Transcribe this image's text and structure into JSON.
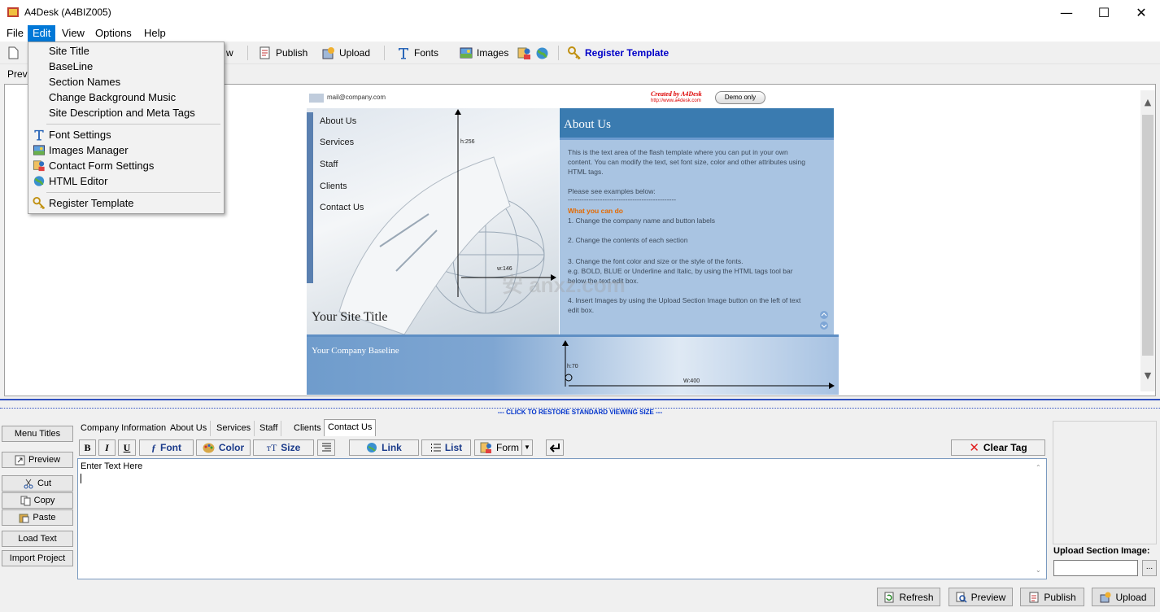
{
  "window": {
    "title": "A4Desk (A4BIZ005)",
    "controls": {
      "minimize": "—",
      "maximize": "☐",
      "close": "✕"
    }
  },
  "menubar": {
    "items": [
      "File",
      "Edit",
      "View",
      "Options",
      "Help"
    ],
    "active": "Edit"
  },
  "toolbar": {
    "partial_label": "w",
    "publish": "Publish",
    "upload": "Upload",
    "fonts": "Fonts",
    "images": "Images",
    "register": "Register Template"
  },
  "edit_menu": {
    "group1": [
      "Site Title",
      "BaseLine",
      "Section Names",
      "Change Background Music",
      "Site Description and Meta Tags"
    ],
    "group2": [
      "Font Settings",
      "Images Manager",
      "Contact Form Settings",
      "HTML Editor"
    ],
    "group3": [
      "Register Template"
    ]
  },
  "preview_tab": "Previ",
  "template": {
    "email": "mail@company.com",
    "created_by": "Created by A4Desk",
    "created_url": "http://www.a4desk.com",
    "demo_badge": "Demo only",
    "nav": [
      "About Us",
      "Services",
      "Staff",
      "Clients",
      "Contact Us"
    ],
    "panel_title": "About Us",
    "body": {
      "p1": "This is the text area of the flash template where you can put in your own content.  You can modify the text, set font size, color and other attributes using HTML tags.",
      "p2": "Please see examples below:",
      "rule": "-----------------------------------------------",
      "what_label": "What you can do",
      "item1": "1. Change the company name and button labels",
      "item2": "2. Change the contents of each section",
      "item3": "3. Change the font color and size or the style of the fonts.",
      "item3b": "e.g. BOLD, BLUE  or Underline and Italic, by using the HTML tags tool bar below the text edit box.",
      "item4": "4. Insert Images by using the Upload Section Image button on the left of text edit box."
    },
    "site_title": "Your Site Title",
    "baseline": "Your Company Baseline",
    "dims": {
      "h256": "h:256",
      "w146": "w:146",
      "h70": "h:70",
      "w400": "W:400"
    }
  },
  "restore_text": "--- CLICK TO RESTORE STANDARD VIEWING SIZE ---",
  "watermark": "安 anxz.com",
  "side_buttons": {
    "menu_titles": "Menu Titles",
    "preview": "Preview",
    "cut": "Cut",
    "copy": "Copy",
    "paste": "Paste",
    "load_text": "Load Text",
    "import_project": "Import Project"
  },
  "section_tabs": [
    "Company Information",
    "About Us",
    "Services",
    "Staff",
    "Clients",
    "Contact Us"
  ],
  "active_section_tab": "Contact Us",
  "format_bar": {
    "bold": "B",
    "italic": "I",
    "underline": "U",
    "font": "Font",
    "color": "Color",
    "size": "Size",
    "link": "Link",
    "list": "List",
    "form": "Form",
    "clear_tag": "Clear Tag"
  },
  "editor": {
    "text": "Enter Text Here"
  },
  "upload_panel": {
    "label": "Upload Section Image:"
  },
  "bottom_buttons": {
    "refresh": "Refresh",
    "preview": "Preview",
    "publish": "Publish",
    "upload": "Upload"
  },
  "colors": {
    "accent": "#0078d7",
    "panel": "#a9c4e2",
    "panel_header": "#3a7bb0",
    "restore_text": "#0033cc"
  }
}
